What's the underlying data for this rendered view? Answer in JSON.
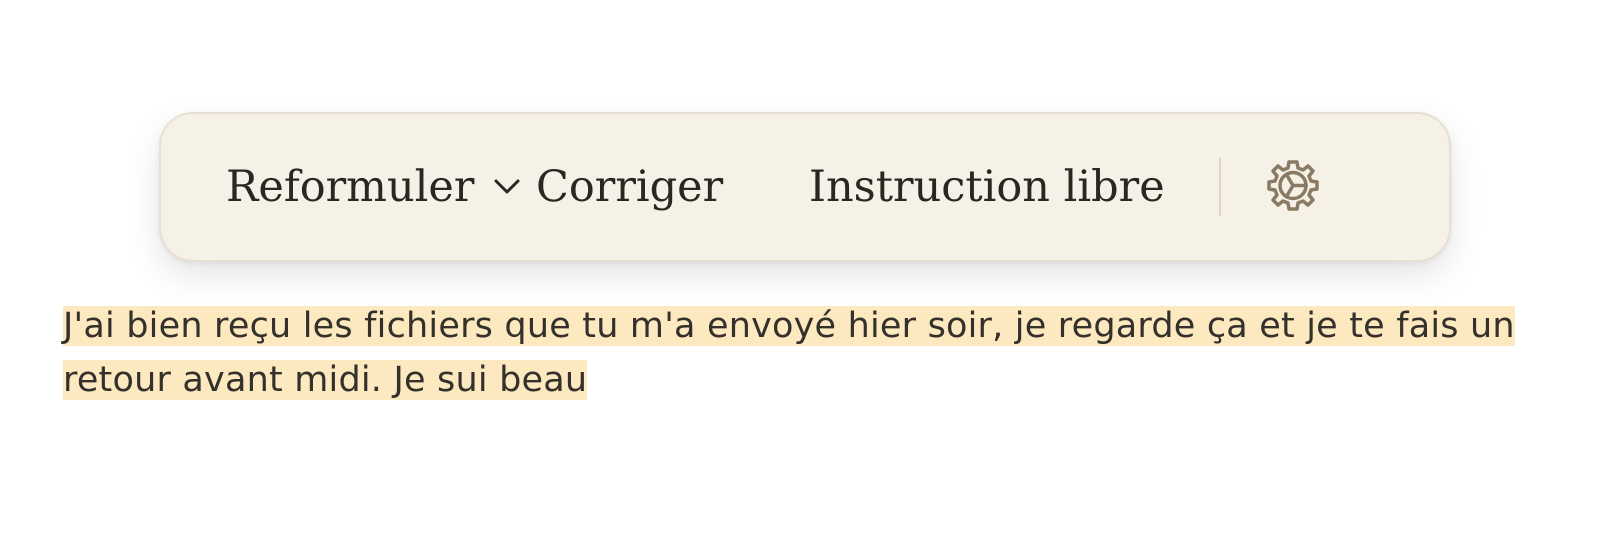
{
  "toolbar": {
    "reformuler_label": "Reformuler",
    "corriger_label": "Corriger",
    "instruction_label": "Instruction libre",
    "icons": [
      "chevron-down-icon",
      "gear-icon"
    ]
  },
  "editor": {
    "selected_text": "J'ai bien reçu les fichiers que tu m'a envoyé hier soir, je regarde ça et je te fais un retour avant midi. Je sui beau"
  },
  "colors": {
    "toolbar_background": "#f6f1e6",
    "selection_highlight": "#fde9bf",
    "icon_color": "#8a7a63"
  }
}
